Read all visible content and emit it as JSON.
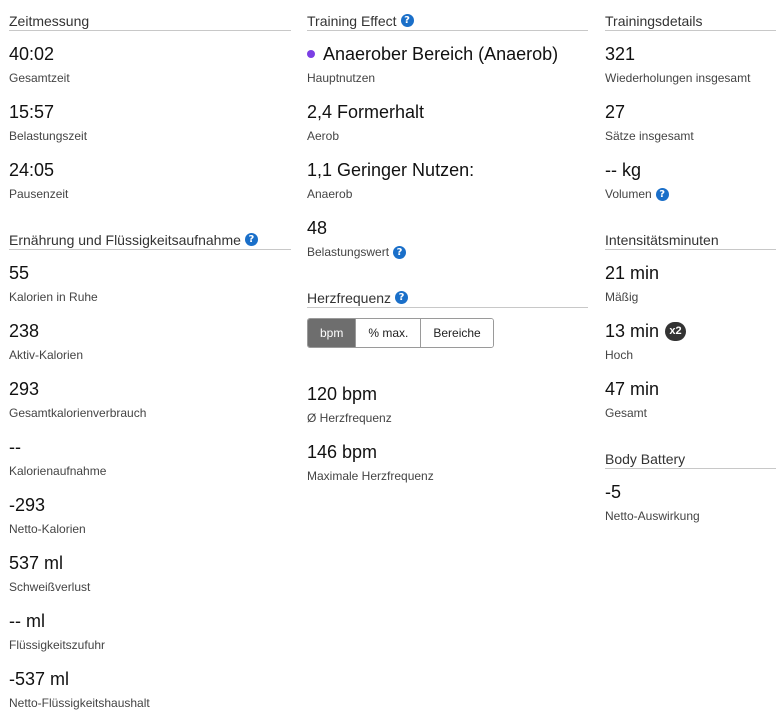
{
  "zeitmessung": {
    "title": "Zeitmessung",
    "stats": [
      {
        "value": "40:02",
        "label": "Gesamtzeit"
      },
      {
        "value": "15:57",
        "label": "Belastungszeit"
      },
      {
        "value": "24:05",
        "label": "Pausenzeit"
      }
    ]
  },
  "ernaehrung": {
    "title": "Ernährung und Flüssigkeitsaufnahme",
    "help": "?",
    "stats": [
      {
        "value": "55",
        "label": "Kalorien in Ruhe"
      },
      {
        "value": "238",
        "label": "Aktiv-Kalorien"
      },
      {
        "value": "293",
        "label": "Gesamtkalorienverbrauch"
      },
      {
        "value": "--",
        "label": "Kalorienaufnahme"
      },
      {
        "value": "-293",
        "label": "Netto-Kalorien"
      },
      {
        "value": "537 ml",
        "label": "Schweißverlust"
      },
      {
        "value": "-- ml",
        "label": "Flüssigkeitszufuhr"
      },
      {
        "value": "-537 ml",
        "label": "Netto-Flüssigkeitshaushalt"
      }
    ]
  },
  "training_effect": {
    "title": "Training Effect",
    "help": "?",
    "primary": {
      "value": "Anaerober Bereich (Anaerob)",
      "label": "Hauptnutzen",
      "dot_color": "#7b3fe4"
    },
    "aerob": {
      "value": "2,4 Formerhalt",
      "label": "Aerob"
    },
    "anaerob": {
      "value": "1,1 Geringer Nutzen:",
      "label": "Anaerob"
    },
    "load": {
      "value": "48",
      "label": "Belastungswert"
    }
  },
  "herzfrequenz": {
    "title": "Herzfrequenz",
    "help": "?",
    "tabs": [
      "bpm",
      "% max.",
      "Bereiche"
    ],
    "active_tab": "bpm",
    "avg": {
      "value": "120 bpm",
      "label": "Ø Herzfrequenz"
    },
    "max": {
      "value": "146 bpm",
      "label": "Maximale Herzfrequenz"
    }
  },
  "trainingsdetails": {
    "title": "Trainingsdetails",
    "reps": {
      "value": "321",
      "label": "Wiederholungen insgesamt"
    },
    "sets": {
      "value": "27",
      "label": "Sätze insgesamt"
    },
    "volume": {
      "value": "-- kg",
      "label": "Volumen"
    }
  },
  "intensitaet": {
    "title": "Intensitätsminuten",
    "moderate": {
      "value": "21 min",
      "label": "Mäßig"
    },
    "high": {
      "value": "13 min",
      "label": "Hoch",
      "badge": "x2"
    },
    "total": {
      "value": "47 min",
      "label": "Gesamt"
    }
  },
  "body_battery": {
    "title": "Body Battery",
    "net": {
      "value": "-5",
      "label": "Netto-Auswirkung"
    }
  },
  "colors": {
    "accent": "#1a6fc9",
    "active_tab": "#6e6e6e",
    "anaerobic_dot": "#7b3fe4"
  }
}
